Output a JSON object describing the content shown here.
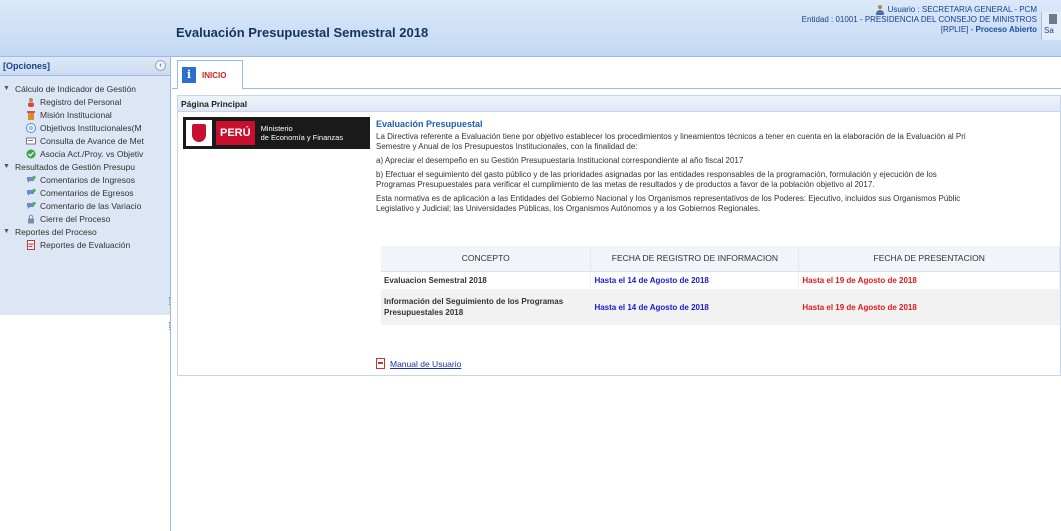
{
  "header": {
    "title": "Evaluación Presupuestal Semestral 2018",
    "user_line": "Usuario : SECRETARIA GENERAL - PCM",
    "entity_line": "Entidad : 01001 - PRESIDENCIA DEL CONSEJO DE MINISTROS",
    "code": "[RPLIE]",
    "separator": " - ",
    "process_status": "Proceso Abierto",
    "exit_label": "Sa"
  },
  "sidebar": {
    "title": "[Opciones]",
    "collapse_glyph": "‹",
    "groups": [
      {
        "label": "Cálculo de Indicador de Gestión",
        "items": [
          {
            "label": "Registro del Personal",
            "icon": "people-icon"
          },
          {
            "label": "Misión Institucional",
            "icon": "building-icon"
          },
          {
            "label": "Objetivos Institucionales(M",
            "icon": "target-icon"
          },
          {
            "label": "Consulta de Avance de Met",
            "icon": "report-icon"
          },
          {
            "label": "Asocia Act./Proy. vs Objetiv",
            "icon": "check-icon"
          }
        ]
      },
      {
        "label": "Resultados de Gestión Presupu",
        "items": [
          {
            "label": "Comentarios de Ingresos",
            "icon": "comment-icon"
          },
          {
            "label": "Comentarios de Egresos",
            "icon": "comment-icon"
          },
          {
            "label": "Comentario de las Variacio",
            "icon": "comment-icon"
          },
          {
            "label": "Cierre del Proceso",
            "icon": "lock-icon"
          }
        ]
      },
      {
        "label": "Reportes del Proceso",
        "items": [
          {
            "label": "Reportes de Evaluación",
            "icon": "pdf-icon"
          }
        ]
      }
    ]
  },
  "tabs": [
    {
      "label": "INICIO",
      "icon": "info-icon"
    }
  ],
  "panel": {
    "title": "Página Principal",
    "logo": {
      "country": "PERÚ",
      "ministry_line1": "Ministerio",
      "ministry_line2": "de Economía y Finanzas"
    },
    "heading": "Evaluación Presupuestal",
    "paragraphs": [
      "La Directiva referente a Evaluación tiene por objetivo establecer los procedimientos y lineamientos técnicos a tener en cuenta en la elaboración de la Evaluación al Pri",
      "Semestre y Anual de los Presupuestos Institucionales, con la finalidad de:",
      "a) Apreciar el desempeño en su Gestión Presupuestaria Institucional correspondiente al año fiscal 2017",
      "b) Efectuar el seguimiento del gasto público y de las prioridades asignadas por las entidades responsables de la programación, formulación y ejecución de los",
      "Programas Presupuestales para verificar el cumplimiento de las metas de resultados y de productos a favor de la población objetivo al 2017.",
      "Esta normativa es de aplicación a las Entidades del Gobierno Nacional y los Organismos representativos de los Poderes: Ejecutivo, incluidos sus Organismos Públic",
      "Legislativo y Judicial; las Universidades Públicas, los Organismos Autónomos y a los Gobiernos Regionales."
    ],
    "table": {
      "headers": [
        "CONCEPTO",
        "FECHA DE REGISTRO DE INFORMACION",
        "FECHA DE PRESENTACION"
      ],
      "rows": [
        [
          "Evaluacion Semestral 2018",
          "Hasta el 14 de Agosto de 2018",
          "Hasta el 19 de Agosto de 2018"
        ],
        [
          "Información del Seguimiento de los Programas Presupuestales 2018",
          "Hasta el 14 de Agosto de 2018",
          "Hasta el 19 de Agosto de 2018"
        ]
      ]
    },
    "manual_link": "Manual de Usuario"
  },
  "colors": {
    "header_bg": "#c3d8f3",
    "accent_blue": "#1a1ad0",
    "deadline_red": "#e01919",
    "tab_red": "#d42020"
  }
}
